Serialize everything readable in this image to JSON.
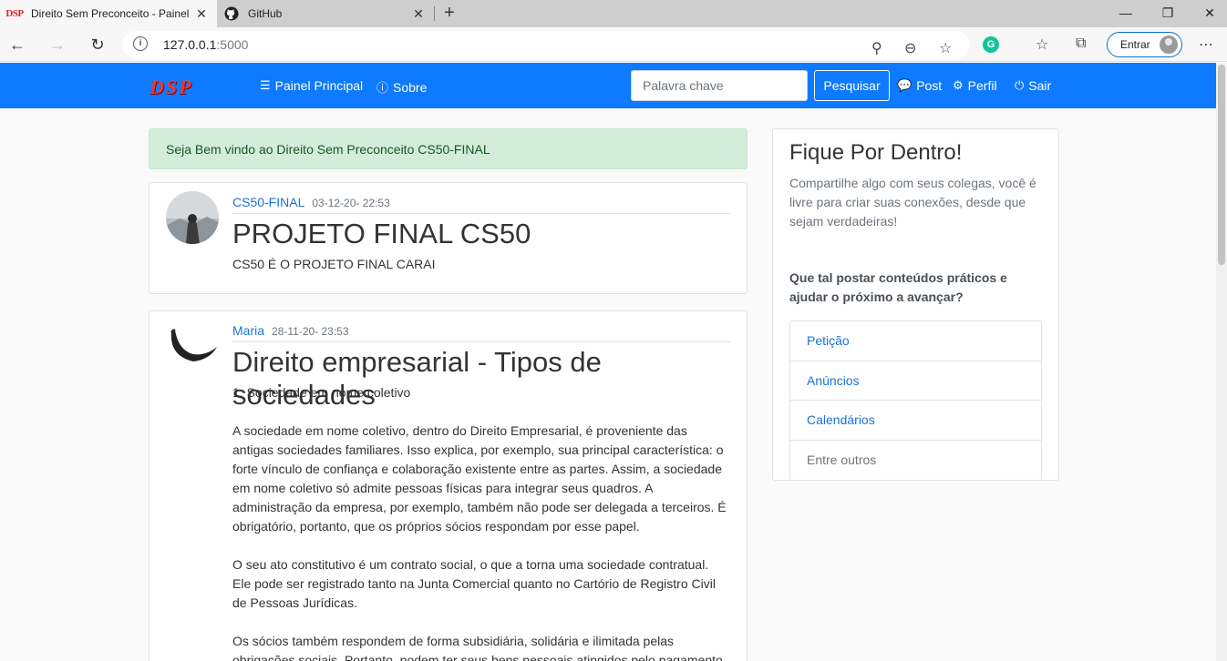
{
  "browser": {
    "tabs": [
      {
        "title": "Direito Sem Preconceito - Painel",
        "favicon": "DSP"
      },
      {
        "title": "GitHub",
        "favicon": "github-icon"
      }
    ],
    "url_host": "127.0.0.1",
    "url_port": ":5000",
    "entrar_label": "Entrar"
  },
  "navbar": {
    "brand": "DSP",
    "links": [
      {
        "label": "Painel Principal",
        "icon": "list-icon"
      },
      {
        "label": "Sobre",
        "icon": "question-icon"
      }
    ],
    "search_placeholder": "Palavra chave",
    "search_button": "Pesquisar",
    "right_links": [
      {
        "label": "Post",
        "icon": "comments-icon"
      },
      {
        "label": "Perfil",
        "icon": "user-cog-icon"
      },
      {
        "label": "Sair",
        "icon": "power-icon"
      }
    ]
  },
  "alert": "Seja Bem vindo ao Direito Sem Preconceito CS50-FINAL",
  "posts": [
    {
      "author": "CS50-FINAL",
      "date": "03-12-20- 22:53",
      "title": "PROJETO FINAL CS50",
      "body": "CS50 É O PROJETO FINAL CARAI"
    },
    {
      "author": "Maria",
      "date": "28-11-20- 23:53",
      "title": "Direito empresarial - Tipos de sociedades",
      "paragraphs": [
        "1. Sociedade em nome coletivo",
        "A sociedade em nome coletivo, dentro do Direito Empresarial, é proveniente das antigas sociedades familiares. Isso explica, por exemplo, sua principal característica: o forte vínculo de confiança e colaboração existente entre as partes. Assim, a sociedade em nome coletivo só admite pessoas físicas para integrar seus quadros. A administração da empresa, por exemplo, também não pode ser delegada a terceiros. É obrigatório, portanto, que os próprios sócios respondam por esse papel.",
        "O seu ato constitutivo é um contrato social, o que a torna uma sociedade contratual. Ele pode ser registrado tanto na Junta Comercial quanto no Cartório de Registro Civil de Pessoas Jurídicas.",
        "Os sócios também respondem de forma subsidiária, solidária e ilimitada pelas obrigações sociais. Portanto, podem ter seus bens pessoais atingidos pelo pagamento"
      ]
    }
  ],
  "sidebar": {
    "title": "Fique Por Dentro!",
    "description": "Compartilhe algo com seus colegas, você é livre para criar suas conexões, desde que sejam verdadeiras!",
    "question": "Que tal postar conteúdos práticos e ajudar o próximo a avançar?",
    "items": [
      "Petição",
      "Anúncios",
      "Calendários",
      "Entre outros"
    ]
  }
}
